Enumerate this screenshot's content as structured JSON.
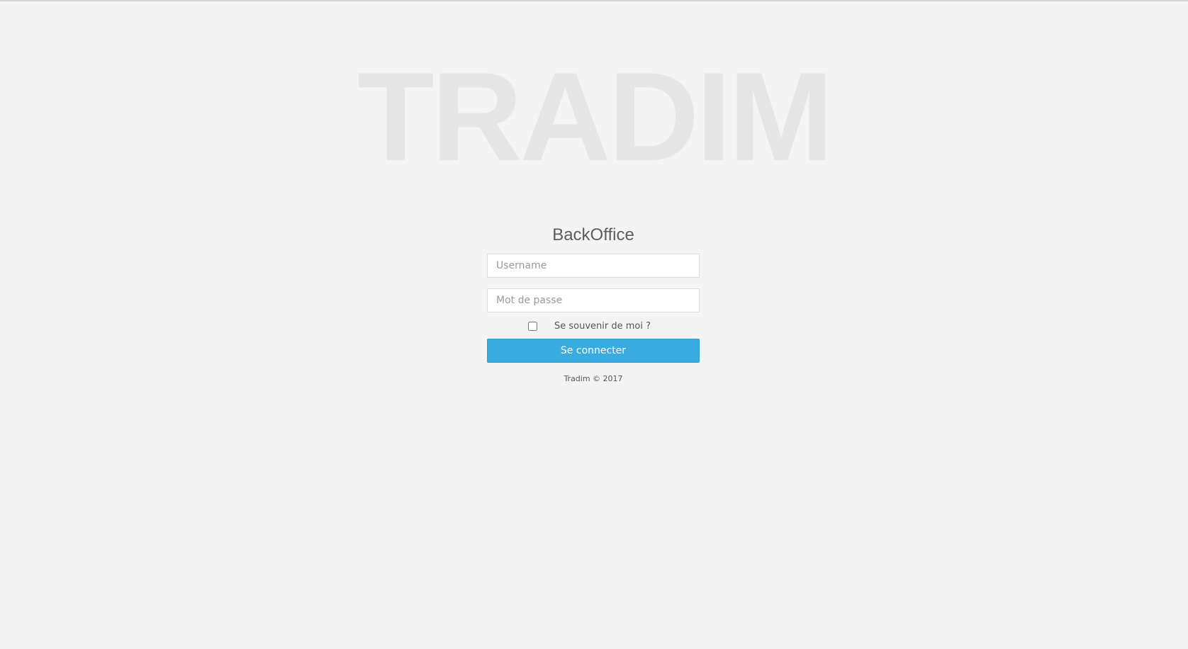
{
  "logo": {
    "text": "TRADIM"
  },
  "login": {
    "title": "BackOffice",
    "username_placeholder": "Username",
    "username_value": "",
    "password_placeholder": "Mot de passe",
    "password_value": "",
    "remember_label": "Se souvenir de moi ?",
    "remember_checked": false,
    "submit_label": "Se connecter"
  },
  "footer": {
    "text": "Tradim © 2017"
  },
  "colors": {
    "background": "#f4f4f4",
    "logo": "#e6e6e6",
    "button": "#3aabe0",
    "button_text": "#ffffff"
  }
}
